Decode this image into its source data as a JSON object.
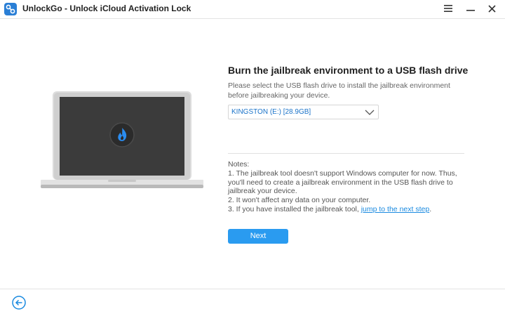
{
  "window": {
    "title": "UnlockGo - Unlock iCloud Activation Lock"
  },
  "main": {
    "heading": "Burn the jailbreak environment to a USB flash drive",
    "description": "Please select the USB flash drive to install the jailbreak environment before jailbreaking your device.",
    "drive_select": {
      "selected": "KINGSTON (E:) [28.9GB]"
    },
    "notes": {
      "title": "Notes:",
      "lines": [
        "1. The jailbreak tool doesn't support Windows computer for now. Thus,",
        "you'll need to create a jailbreak environment in the USB flash drive to",
        "jailbreak your device.",
        "2. It won't affect any data on your computer."
      ],
      "last_prefix": "3. If you have installed the jailbreak tool, ",
      "link_text": "jump to the next step",
      "last_suffix": "."
    },
    "next_label": "Next"
  },
  "icons": {
    "app": "unlockgo-logo-icon",
    "menu": "hamburger-menu-icon",
    "minimize": "minimize-icon",
    "close": "close-icon",
    "dropdown": "chevron-down-icon",
    "back": "back-arrow-icon",
    "flame": "flame-logo-icon"
  },
  "colors": {
    "accent": "#2a9bf0",
    "link": "#1a8ae0",
    "select_text": "#1a73c9",
    "screen": "#3a3a3a",
    "laptop_frame": "#d9d9d9"
  }
}
